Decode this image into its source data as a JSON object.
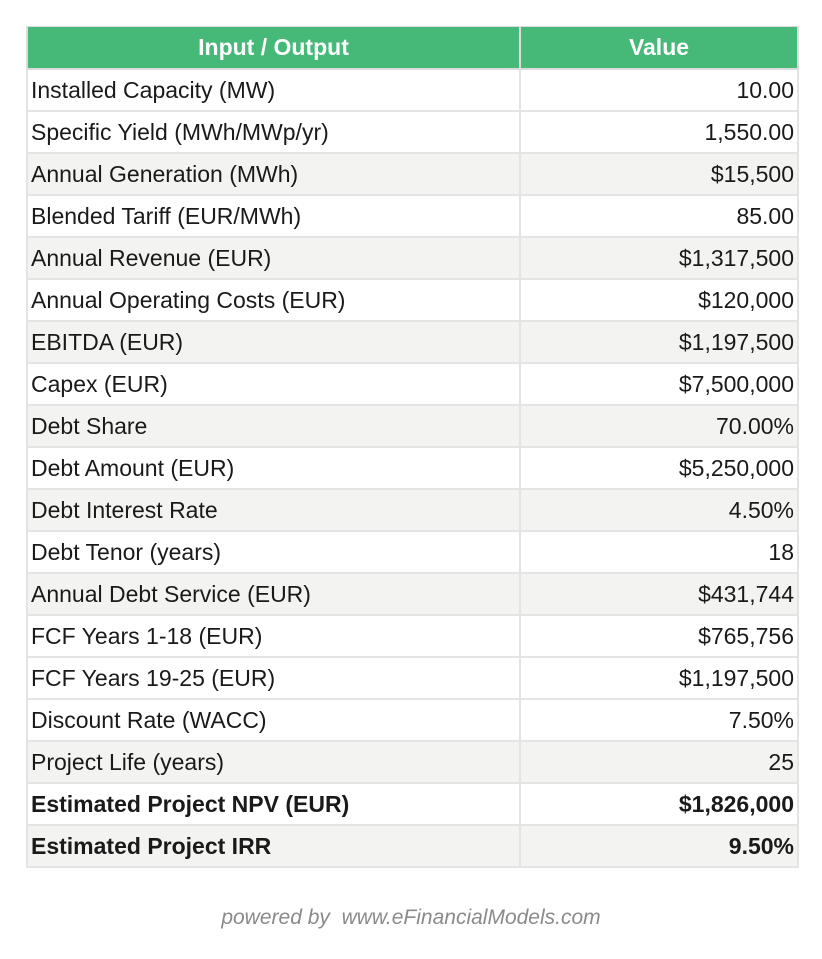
{
  "table": {
    "headers": [
      "Input / Output",
      "Value"
    ],
    "rows": [
      {
        "label": "Installed Capacity (MW)",
        "value": "10.00"
      },
      {
        "label": "Specific Yield (MWh/MWp/yr)",
        "value": "1,550.00"
      },
      {
        "label": "Annual Generation (MWh)",
        "value": "$15,500"
      },
      {
        "label": "Blended Tariff (EUR/MWh)",
        "value": "85.00"
      },
      {
        "label": "Annual Revenue (EUR)",
        "value": "$1,317,500"
      },
      {
        "label": "Annual Operating Costs (EUR)",
        "value": "$120,000"
      },
      {
        "label": "EBITDA (EUR)",
        "value": "$1,197,500"
      },
      {
        "label": "Capex (EUR)",
        "value": "$7,500,000"
      },
      {
        "label": "Debt Share",
        "value": "70.00%"
      },
      {
        "label": "Debt Amount (EUR)",
        "value": "$5,250,000"
      },
      {
        "label": "Debt Interest Rate",
        "value": "4.50%"
      },
      {
        "label": "Debt Tenor (years)",
        "value": "18"
      },
      {
        "label": "Annual Debt Service (EUR)",
        "value": "$431,744"
      },
      {
        "label": "FCF Years 1-18 (EUR)",
        "value": "$765,756"
      },
      {
        "label": "FCF Years 19-25 (EUR)",
        "value": "$1,197,500"
      },
      {
        "label": "Discount Rate (WACC)",
        "value": "7.50%"
      },
      {
        "label": "Project Life (years)",
        "value": "25"
      },
      {
        "label": "Estimated Project NPV (EUR)",
        "value": "$1,826,000"
      },
      {
        "label": "Estimated Project IRR",
        "value": "9.50%"
      }
    ]
  },
  "footer": {
    "text": "powered by  www.eFinancialModels.com"
  },
  "colors": {
    "header_bg": "#46b978",
    "header_text": "#ffffff",
    "row_alt_bg": "#f3f3f1",
    "footer_text": "#8a8a8a"
  }
}
